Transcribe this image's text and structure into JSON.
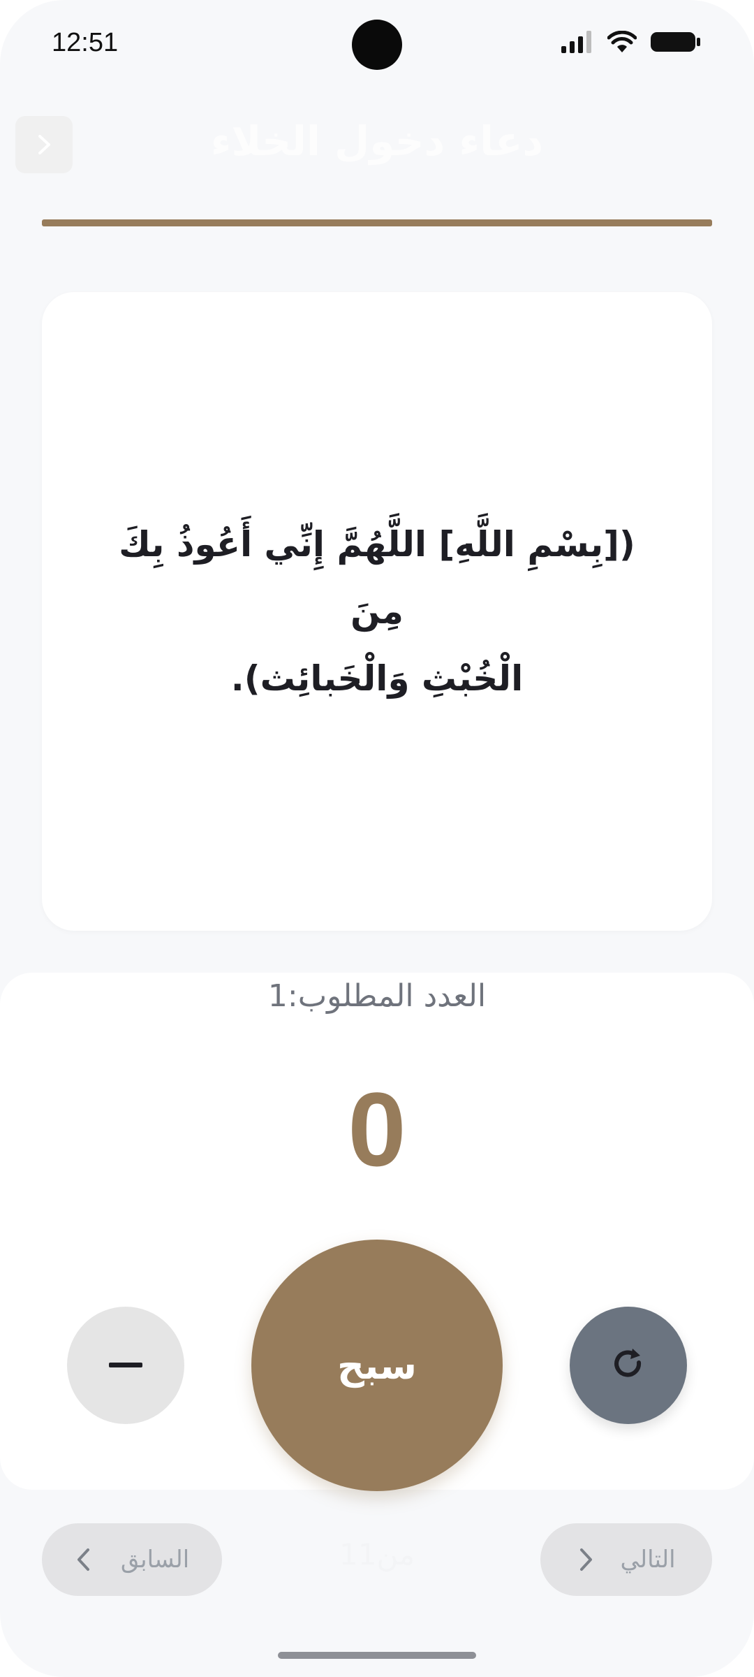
{
  "status_bar": {
    "time": "12:51"
  },
  "header": {
    "title": "دعاء دخول الخلاء",
    "back_icon": "chevron-right-icon",
    "progress_fraction": 1.0
  },
  "dhikr": {
    "text_line_1": "([بِسْمِ اللَّهِ] اللَّهُمَّ إِنِّي أَعُوذُ بِكَ مِنَ",
    "text_line_2": "الْخُبْثِ وَالْخَبائِث)."
  },
  "counter": {
    "required_label": "العدد المطلوب:1",
    "value": "0",
    "tasbih_label": "سبح",
    "minus_icon": "minus-icon",
    "reset_icon": "refresh-icon"
  },
  "navigation": {
    "previous_label": "السابق",
    "next_label": "التالي",
    "page_indicator": "من11"
  },
  "colors": {
    "accent": "#977c5b",
    "reset_button": "#6b7480",
    "background": "#f7f8fa"
  }
}
